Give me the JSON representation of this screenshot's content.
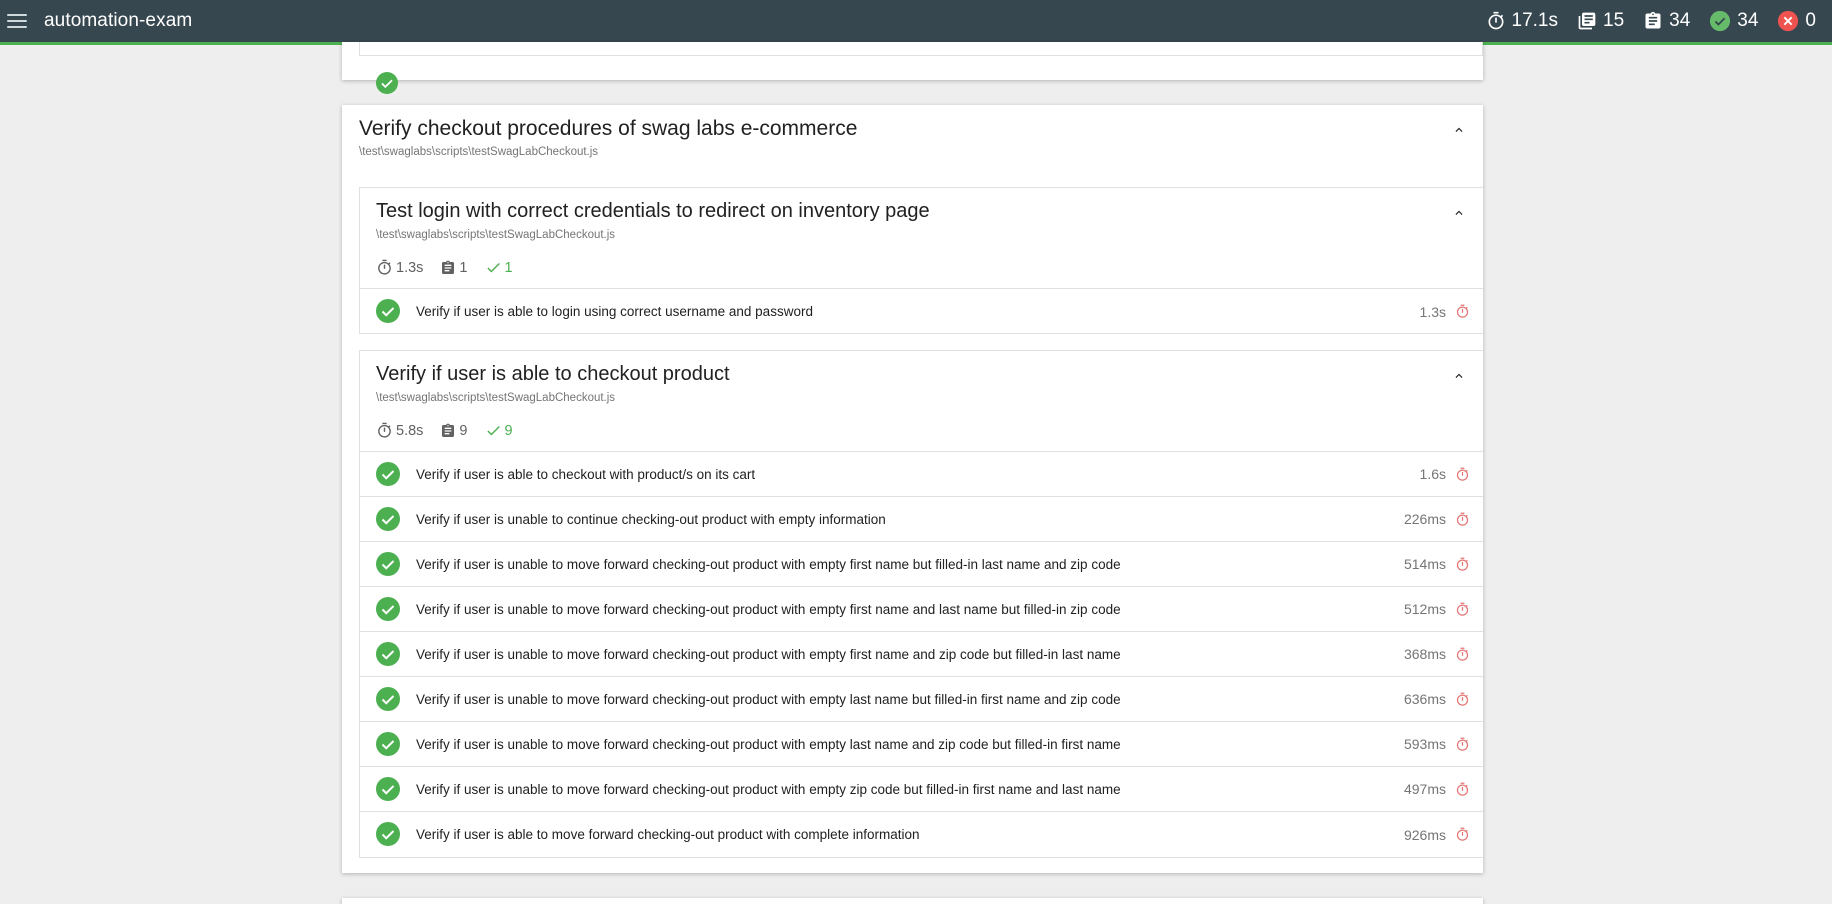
{
  "app": {
    "title": "automation-exam"
  },
  "stats": {
    "duration": "17.1s",
    "suites": "15",
    "tests": "34",
    "passed": "34",
    "failed": "0"
  },
  "colors": {
    "topbar": "#37474f",
    "pass": "#4caf50",
    "fail": "#e53935",
    "timer": "#e57373"
  },
  "suite": {
    "title": "Verify checkout procedures of swag labs e-commerce",
    "file": "\\test\\swaglabs\\scripts\\testSwagLabCheckout.js",
    "subsuites": [
      {
        "title": "Test login with correct credentials to redirect on inventory page",
        "file": "\\test\\swaglabs\\scripts\\testSwagLabCheckout.js",
        "duration": "1.3s",
        "tests": "1",
        "passes": "1",
        "items": [
          {
            "title": "Verify if user is able to login using correct username and password",
            "duration": "1.3s"
          }
        ]
      },
      {
        "title": "Verify if user is able to checkout product",
        "file": "\\test\\swaglabs\\scripts\\testSwagLabCheckout.js",
        "duration": "5.8s",
        "tests": "9",
        "passes": "9",
        "items": [
          {
            "title": "Verify if user is able to checkout with product/s on its cart",
            "duration": "1.6s"
          },
          {
            "title": "Verify if user is unable to continue checking-out product with empty information",
            "duration": "226ms"
          },
          {
            "title": "Verify if user is unable to move forward checking-out product with empty first name but filled-in last name and zip code",
            "duration": "514ms"
          },
          {
            "title": "Verify if user is unable to move forward checking-out product with empty first name and last name but filled-in zip code",
            "duration": "512ms"
          },
          {
            "title": "Verify if user is unable to move forward checking-out product with empty first name and zip code but filled-in last name",
            "duration": "368ms"
          },
          {
            "title": "Verify if user is unable to move forward checking-out product with empty last name but filled-in first name and zip code",
            "duration": "636ms"
          },
          {
            "title": "Verify if user is unable to move forward checking-out product with empty last name and zip code but filled-in first name",
            "duration": "593ms"
          },
          {
            "title": "Verify if user is unable to move forward checking-out product with empty zip code but filled-in first name and last name",
            "duration": "497ms"
          },
          {
            "title": "Verify if user is able to move forward checking-out product with complete information",
            "duration": "926ms"
          }
        ]
      }
    ]
  }
}
